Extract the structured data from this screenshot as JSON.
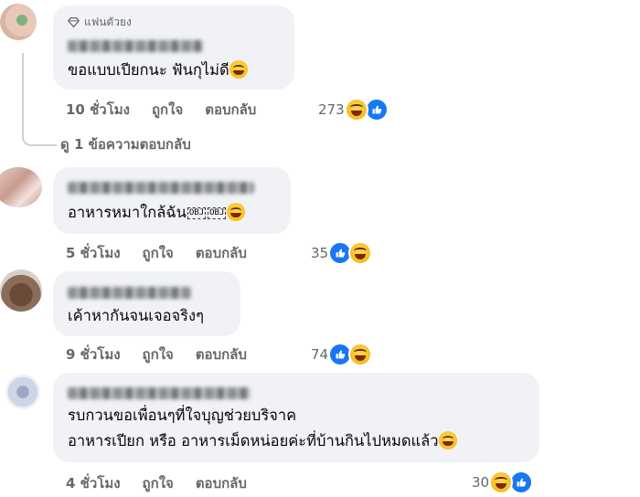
{
  "comments": [
    {
      "badge": "แฟนตัวยง",
      "text_lines": [
        "ขอแบบเปียกนะ ฟันกุไม่ดี"
      ],
      "time": "10 ชั่วโมง",
      "like": "ถูกใจ",
      "reply": "ตอบกลับ",
      "reaction_count": "273",
      "reactions": [
        "haha",
        "like"
      ],
      "view_replies": "ดู 1 ข้อความตอบกลับ"
    },
    {
      "text_lines": [
        "อาหารหมาใกล้ฉัน"
      ],
      "obj_marks": [
        "OBJ",
        "OBJ"
      ],
      "time": "5 ชั่วโมง",
      "like": "ถูกใจ",
      "reply": "ตอบกลับ",
      "reaction_count": "35",
      "reactions": [
        "like",
        "haha"
      ]
    },
    {
      "text_lines": [
        "เค้าหากันจนเจอจริงๆ"
      ],
      "time": "9 ชั่วโมง",
      "like": "ถูกใจ",
      "reply": "ตอบกลับ",
      "reaction_count": "74",
      "reactions": [
        "like",
        "haha"
      ]
    },
    {
      "text_lines": [
        "รบกวนขอเพื่อนๆที่ใจบุญช่วยบริจาค",
        "อาหารเปียก หรือ อาหารเม็ดหน่อยค่ะที่บ้านกินไปหมดแล้ว"
      ],
      "time": "4 ชั่วโมง",
      "like": "ถูกใจ",
      "reply": "ตอบกลับ",
      "reaction_count": "30",
      "reactions": [
        "haha",
        "like"
      ]
    }
  ],
  "colors": {
    "bubble": "#f0f2f5",
    "meta": "#65676b",
    "like_blue": "#1877f2",
    "haha_yellow": "#f7b500"
  }
}
